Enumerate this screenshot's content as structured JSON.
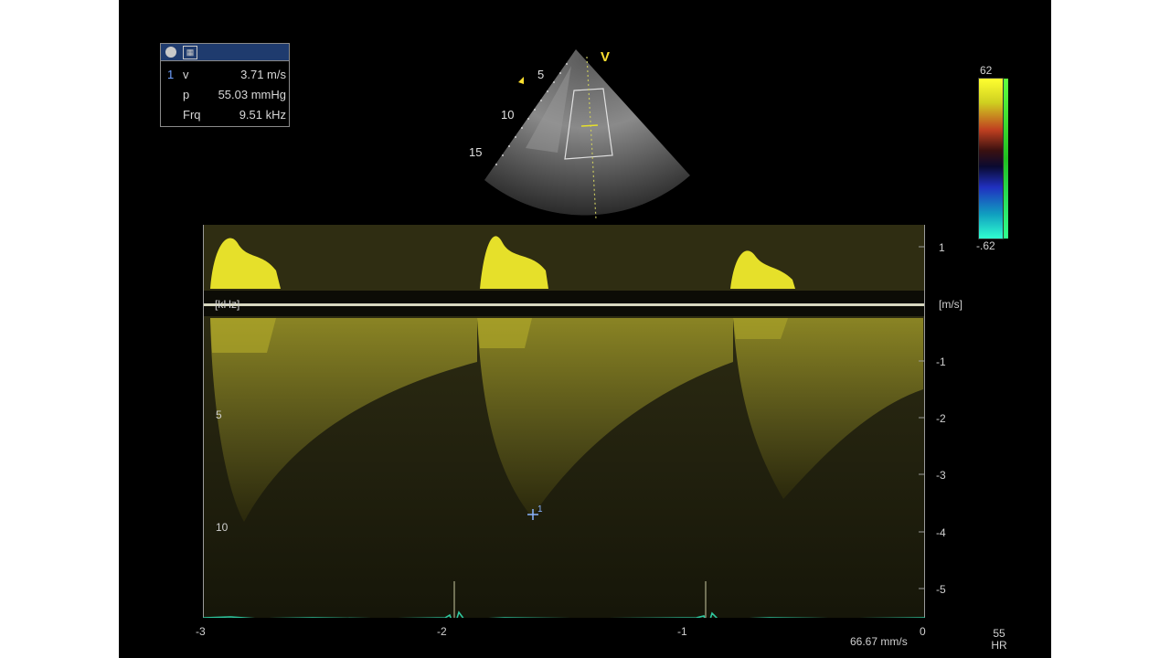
{
  "measurement": {
    "rows": [
      {
        "index": "1",
        "label": "v",
        "value": "3.71 m/s"
      },
      {
        "index": "",
        "label": "p",
        "value": "55.03 mmHg"
      },
      {
        "index": "",
        "label": "Frq",
        "value": "9.51 kHz"
      }
    ]
  },
  "sector": {
    "depth_labels": [
      "5",
      "10",
      "15"
    ],
    "marker": "V"
  },
  "color_bar": {
    "top_label": "62",
    "bottom_label": "-.62"
  },
  "spectrum": {
    "left_unit": "[kHz]",
    "right_unit": "[m/s]",
    "right_ticks": [
      "1",
      "-1",
      "-2",
      "-3",
      "-4",
      "-5"
    ],
    "left_ticks": [
      "5",
      "10"
    ],
    "bottom_ticks": [
      "-3",
      "-2",
      "-1",
      "0"
    ],
    "sweep_speed": "66.67 mm/s",
    "cursor_label": "1"
  },
  "heart_rate": {
    "value": "55",
    "label": "HR"
  },
  "colors": {
    "doppler": "#e6e02a",
    "ecg": "#2fc9a0",
    "baseline_marker": "#2ee62e"
  }
}
